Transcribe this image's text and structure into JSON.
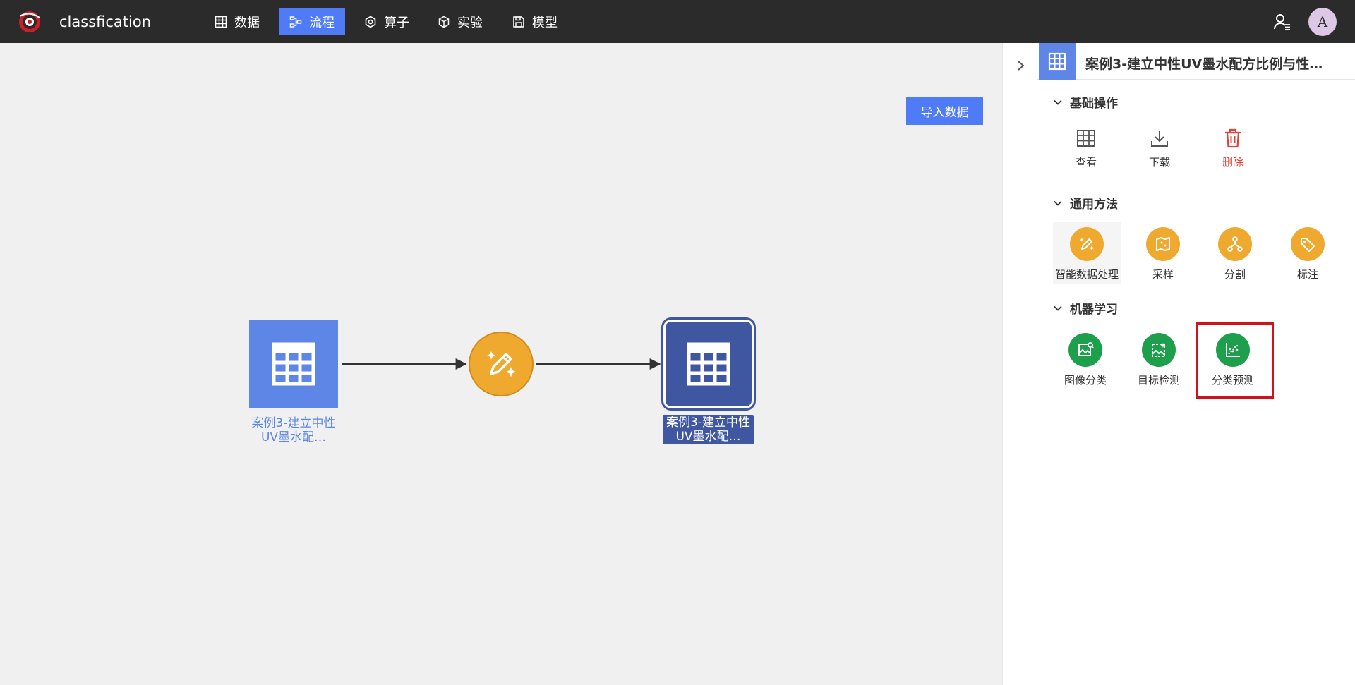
{
  "app": {
    "title": "classfication"
  },
  "nav": {
    "items": [
      {
        "label": "数据",
        "icon": "table-icon"
      },
      {
        "label": "流程",
        "icon": "flow-icon",
        "active": true
      },
      {
        "label": "算子",
        "icon": "hexagon-icon"
      },
      {
        "label": "实验",
        "icon": "cube-icon"
      },
      {
        "label": "模型",
        "icon": "save-icon"
      }
    ]
  },
  "user": {
    "avatar_letter": "A"
  },
  "canvas": {
    "import_button": "导入数据",
    "nodes": [
      {
        "type": "dataset",
        "label": "案例3-建立中性UV墨水配…"
      },
      {
        "type": "operator",
        "icon": "magic-pencil-icon"
      },
      {
        "type": "dataset",
        "label": "案例3-建立中性UV墨水配…",
        "selected": true
      }
    ]
  },
  "panel": {
    "title": "案例3-建立中性UV墨水配方比例与性…",
    "sections": [
      {
        "title": "基础操作",
        "items": [
          {
            "label": "查看",
            "icon": "table-icon"
          },
          {
            "label": "下载",
            "icon": "download-icon"
          },
          {
            "label": "删除",
            "icon": "trash-icon",
            "color": "#e0423a"
          }
        ]
      },
      {
        "title": "通用方法",
        "items": [
          {
            "label": "智能数据处理",
            "icon": "magic-pencil-icon",
            "color": "#f0a92f"
          },
          {
            "label": "采样",
            "icon": "map-icon",
            "color": "#f0a92f"
          },
          {
            "label": "分割",
            "icon": "split-icon",
            "color": "#f0a92f"
          },
          {
            "label": "标注",
            "icon": "tag-icon",
            "color": "#f0a92f"
          }
        ]
      },
      {
        "title": "机器学习",
        "items": [
          {
            "label": "图像分类",
            "icon": "image-classify-icon",
            "color": "#1d9f4b"
          },
          {
            "label": "目标检测",
            "icon": "object-detect-icon",
            "color": "#1d9f4b"
          },
          {
            "label": "分类预测",
            "icon": "scatter-predict-icon",
            "color": "#1d9f4b",
            "highlighted": true
          }
        ]
      }
    ]
  }
}
